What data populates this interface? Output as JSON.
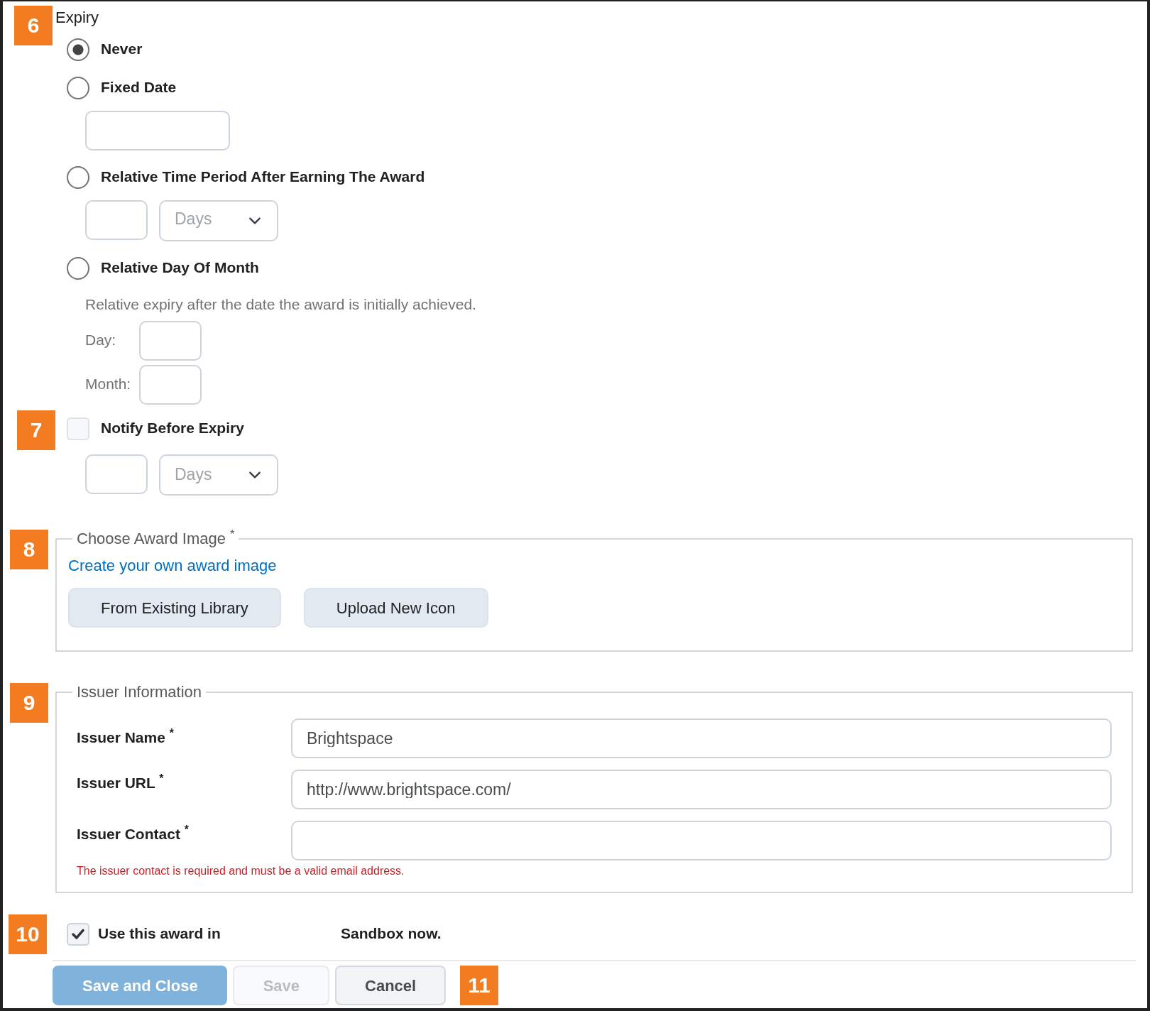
{
  "expiry": {
    "callout": "6",
    "label": "Expiry",
    "options": [
      {
        "kind": "plain",
        "label": "Never",
        "selected": true
      },
      {
        "kind": "date",
        "label": "Fixed Date",
        "selected": false
      },
      {
        "kind": "period",
        "label": "Relative Time Period After Earning The Award",
        "selected": false,
        "unit": "Days"
      },
      {
        "kind": "day_month",
        "label": "Relative Day Of Month",
        "selected": false,
        "hint": "Relative expiry after the date the award is initially achieved.",
        "day_label": "Day:",
        "month_label": "Month:"
      }
    ]
  },
  "notify": {
    "callout": "7",
    "label": "Notify Before Expiry",
    "checked": false,
    "unit": "Days"
  },
  "award_image": {
    "callout": "8",
    "legend": "Choose Award Image $^{*}$",
    "link": "Create your own award image",
    "buttons": [
      "From Existing Library",
      "Upload New Icon"
    ]
  },
  "issuer": {
    "callout": "9",
    "legend": "Issuer Information",
    "fields": [
      {
        "label": "Issuer Name $^{*}$",
        "value": "Brightspace"
      },
      {
        "label": "Issuer URL $^{*}$",
        "value": "http://www.brightspace.com/"
      },
      {
        "label": "Issuer Contact $^{*}$"
      }
    ],
    "error": "The issuer contact is required and must be a valid email address."
  },
  "use_award": {
    "callout": "10",
    "checked": true,
    "label": "Use this award in",
    "org": "Sandbox now."
  },
  "actions": {
    "callout": "11",
    "buttons": [
      {
        "label": "Save and Close",
        "kind": "primary",
        "disabled": false
      },
      {
        "label": "Save",
        "kind": "secondary",
        "disabled": true
      },
      {
        "label": "Cancel",
        "kind": "secondary",
        "disabled": false
      }
    ]
  }
}
